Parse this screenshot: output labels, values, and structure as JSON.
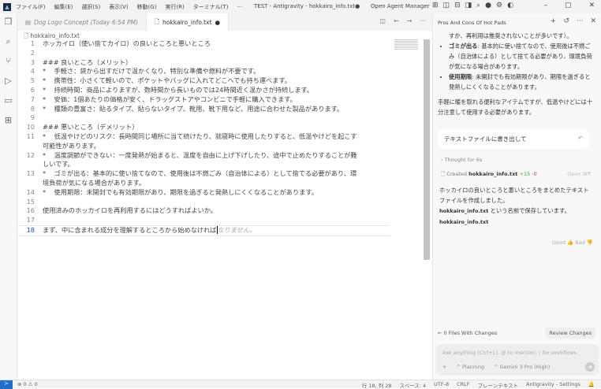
{
  "titlebar": {
    "menus": [
      "ファイル(F)",
      "編集(E)",
      "選択(S)",
      "表示(V)",
      "移動(G)",
      "実行(R)",
      "ターミナル(T)",
      "···"
    ],
    "title": "TEST - Antigravity - hokkairo_info.txt●",
    "agent_manager": "Open Agent Manager"
  },
  "activity": {
    "badge": "1"
  },
  "tabs": [
    {
      "label": "Dog Logo Concept (Today 6:54 PM)"
    },
    {
      "label": "hokkairo_info.txt",
      "modified": "●"
    }
  ],
  "breadcrumb": "hokkairo_info.txt",
  "editor": {
    "lines": [
      {
        "n": "1",
        "t": "ホッカイロ（使い捨てカイロ）の良いところと悪いところ"
      },
      {
        "n": "2",
        "t": ""
      },
      {
        "n": "3",
        "t": "### 良いところ（メリット）"
      },
      {
        "n": "4",
        "t": "*    手軽さ：袋から出すだけで温かくなり、特別な準備や燃料が不要です。"
      },
      {
        "n": "5",
        "t": "*    携帯性：小さくて軽いので、ポケットやバッグに入れてどこへでも持ち運べます。"
      },
      {
        "n": "6",
        "t": "*    持続時間：商品によりますが、数時間から長いものでは24時間近く温かさが持続します。"
      },
      {
        "n": "7",
        "t": "*    安価：1個あたりの価格が安く、ドラッグストアやコンビニで手軽に購入できます。"
      },
      {
        "n": "8",
        "t": "*    種類の豊富さ：貼るタイプ、貼らないタイプ、靴用、靴下用など、用途に合わせた製品があります。"
      },
      {
        "n": "9",
        "t": ""
      },
      {
        "n": "10",
        "t": "### 悪いところ（デメリット）"
      },
      {
        "n": "11",
        "t": "*    低温やけどのリスク：長時間同じ場所に当て続けたり、就寝時に使用したりすると、低温やけどを起こす"
      },
      {
        "n": "",
        "t": "可能性があります。"
      },
      {
        "n": "12",
        "t": "*    温度調節ができない：一度発熱が始まると、温度を自由に上げ下げしたり、途中で止めたりすることが難"
      },
      {
        "n": "",
        "t": "しいです。"
      },
      {
        "n": "13",
        "t": "*    ゴミが出る：基本的に使い捨てなので、使用後は不燃ごみ（自治体による）として捨てる必要があり、環"
      },
      {
        "n": "",
        "t": "境負荷が気になる場合があります。"
      },
      {
        "n": "14",
        "t": "*    使用期限：未開封でも有効期限があり、期限を過ぎると発熱しにくくなることがあります。"
      },
      {
        "n": "15",
        "t": ""
      },
      {
        "n": "16",
        "t": "使用済みのホッカイロを再利用するにはどうすればよいか。"
      },
      {
        "n": "17",
        "t": ""
      }
    ],
    "current": {
      "n": "18",
      "t": "まず、中に含まれる成分を理解するところから始めなければ",
      "ghost": "なりません。"
    }
  },
  "panel": {
    "title": "Pros And Cons Of Hot Pads",
    "top_text": "すか、再利用は推奨されないことが多いです）。",
    "bullets": [
      {
        "b": "ゴミが出る",
        "t": ": 基本的に使い捨てなので、使用後は不燃ごみ（自治体による）として捨てる必要があり、環境負荷が気になる場合があります。"
      },
      {
        "b": "使用期限",
        "t": ": 未開封でも有効期限があり、期限を過ぎると発熱しにくくなることがあります。"
      }
    ],
    "summary": "手軽に暖を取れる便利なアイテムですが、低温やけどには十分注意して使用する必要があります。",
    "user_msg": "テキストファイルに書き出して",
    "thought": "Thought for 6s",
    "created_label": "Created",
    "created_file": "hokkairo_info.txt",
    "added": "+15",
    "removed": "-0",
    "open_diff": "Open diff",
    "response": "ホッカイロの良いところと悪いところをまとめたテキストファイルを作成しました。",
    "saved_file": "hokkairo_info.txt",
    "saved_suffix": "という名前で保存しています。",
    "file_link": "hokkairo_info.txt",
    "good": "Good",
    "bad": "Bad",
    "files_changes": "0 Files With Changes",
    "review": "Review Changes",
    "placeholder": "Ask anything (Ctrl+L), @ to mention, / for workflows",
    "planning": "Planning",
    "model": "Gemini 3 Pro (High)"
  },
  "status": {
    "errors": "0",
    "warnings": "0",
    "position": "行 18, 列 28",
    "spaces": "スペース: 4",
    "encoding": "UTF-8",
    "eol": "CRLF",
    "language": "プレーンテキスト",
    "settings": "Antigravity - Settings"
  }
}
